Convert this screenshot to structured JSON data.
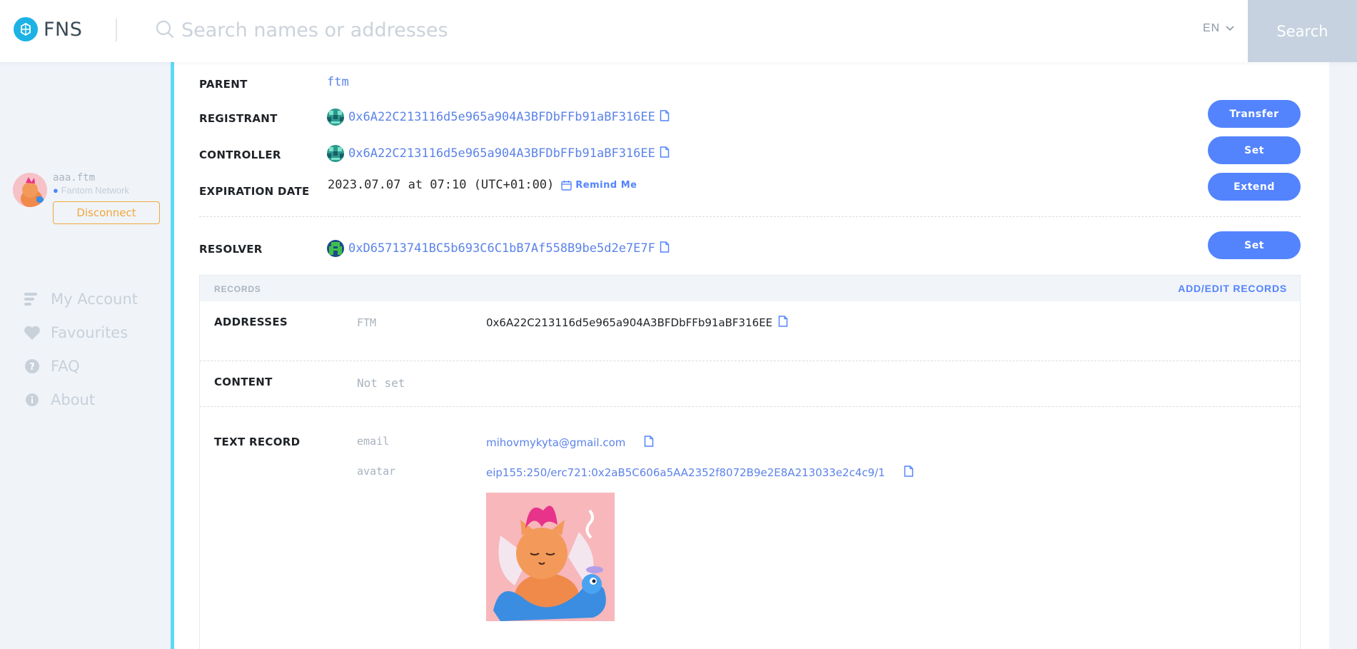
{
  "header": {
    "logo_text": "FNS",
    "search_placeholder": "Search names or addresses",
    "language": "EN",
    "search_button": "Search"
  },
  "account": {
    "name": "aaa.ftm",
    "network": "Fantom Network",
    "disconnect_label": "Disconnect"
  },
  "nav": {
    "items": [
      {
        "label": "My Account",
        "icon": "list-icon"
      },
      {
        "label": "Favourites",
        "icon": "heart-icon"
      },
      {
        "label": "FAQ",
        "icon": "question-icon"
      },
      {
        "label": "About",
        "icon": "info-icon"
      }
    ]
  },
  "details": {
    "parent_label": "PARENT",
    "parent_value": "ftm",
    "registrant_label": "REGISTRANT",
    "registrant_value": "0x6A22C213116d5e965a904A3BFDbFFb91aBF316EE",
    "controller_label": "CONTROLLER",
    "controller_value": "0x6A22C213116d5e965a904A3BFDbFFb91aBF316EE",
    "expiration_label": "EXPIRATION DATE",
    "expiration_value": "2023.07.07 at 07:10 (UTC+01:00)",
    "remind_label": "Remind Me",
    "resolver_label": "RESOLVER",
    "resolver_value": "0xD65713741BC5b693C6C1bB7Af558B9be5d2e7E7F",
    "transfer_button": "Transfer",
    "set_controller_button": "Set",
    "extend_button": "Extend",
    "set_resolver_button": "Set"
  },
  "records": {
    "title": "RECORDS",
    "add_edit_label": "ADD/EDIT RECORDS",
    "addresses_label": "ADDRESSES",
    "addresses": [
      {
        "key": "FTM",
        "value": "0x6A22C213116d5e965a904A3BFDbFFb91aBF316EE"
      }
    ],
    "content_label": "CONTENT",
    "content_value": "Not set",
    "text_record_label": "TEXT RECORD",
    "text_records": [
      {
        "key": "email",
        "value": "mihovmykyta@gmail.com"
      },
      {
        "key": "avatar",
        "value": "eip155:250/erc721:0x2aB5C606a5AA2352f8072B9e2E8A213033e2c4c9/1"
      }
    ]
  },
  "colors": {
    "accent": "#5384fe",
    "logo": "#1cb2e6",
    "sidebar_accent": "#5fd8f8",
    "disconnect": "#f0a73a",
    "search_button": "#c6d2df"
  }
}
